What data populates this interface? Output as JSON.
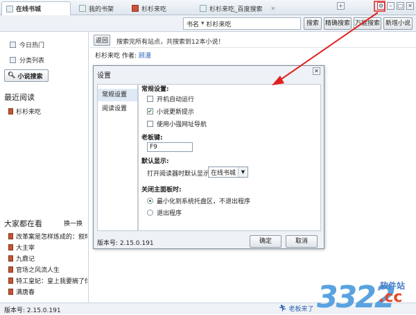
{
  "tabs": [
    {
      "label": "在线书城",
      "active": true
    },
    {
      "label": "我的书架",
      "active": false
    },
    {
      "label": "杉杉来吃",
      "active": false
    },
    {
      "label": "杉杉来吃_百度搜索",
      "active": false
    }
  ],
  "search": {
    "category": "书名",
    "query": "杉杉来吃",
    "buttons": [
      "搜索",
      "精确搜索",
      "万能搜索",
      "新增小说"
    ]
  },
  "sidebar": {
    "links": [
      "今日热门",
      "分类列表"
    ],
    "novel_search": "小说搜索",
    "recent_title": "最近阅读",
    "recent_books": [
      "杉杉来吃"
    ],
    "everyone_title": "大家都在看",
    "refresh": "换一换",
    "everyone_books": [
      "改革案是怎样炼成的：叙时",
      "大主宰",
      "九鼎记",
      "官场之风流人生",
      "特工皇妃：皇上我要摘了你",
      "满唐春"
    ]
  },
  "main": {
    "back": "返回",
    "message": "搜索完所有站点，共搜索到12本小说！",
    "result_title": "杉杉来吃",
    "author_label": "作者:",
    "author": "顾漫"
  },
  "status": {
    "version": "版本号: 2.15.0.191",
    "boss_key": "老板来了"
  },
  "dialog": {
    "title": "设置",
    "nav": [
      "常规设置",
      "阅读设置"
    ],
    "general_title": "常规设置:",
    "checks": [
      {
        "label": "开机自动运行",
        "checked": false
      },
      {
        "label": "小说更新提示",
        "checked": true
      },
      {
        "label": "使用小强网址导航",
        "checked": false
      }
    ],
    "hotkey_title": "老板键:",
    "hotkey": "F9",
    "default_title": "默认显示:",
    "default_label": "打开阅读器时默认显示:",
    "default_value": "在线书城",
    "close_title": "关闭主面板时:",
    "radios": [
      {
        "label": "最小化到系统托盘区，不退出程序",
        "selected": true
      },
      {
        "label": "退出程序",
        "selected": false
      }
    ],
    "version": "版本号: 2.15.0.191",
    "ok": "确定",
    "cancel": "取消"
  },
  "watermark": {
    "number": "3322",
    "soft": "软件站",
    "cc": ".cc"
  },
  "colors": {
    "accent": "#2a63b8",
    "arrow": "#e02020"
  }
}
